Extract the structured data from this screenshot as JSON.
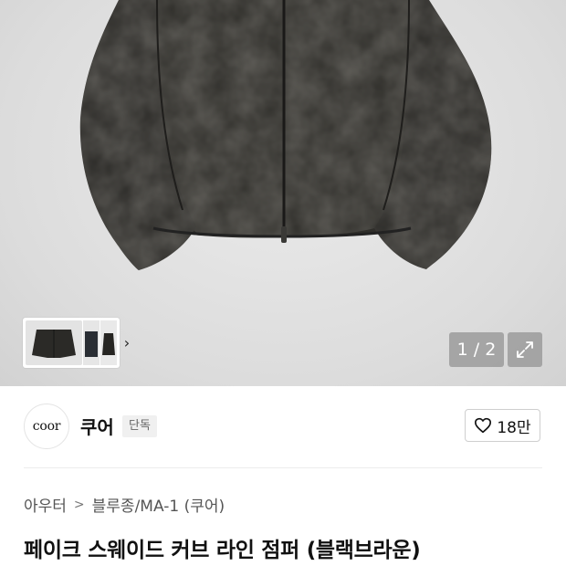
{
  "gallery": {
    "image_alt": "black brown faux suede curve line jumper",
    "pager_text": "1 / 2",
    "thumb_next_icon": "chevron-right-icon",
    "expand_icon": "expand-icon"
  },
  "brand": {
    "logo_text": "coor",
    "name": "쿠어",
    "badge": "단독",
    "like_icon": "heart-outline-icon",
    "like_count": "18만"
  },
  "breadcrumb": {
    "items": [
      "아우터",
      "블루종/MA-1 (쿠어)"
    ],
    "separator_icon": "chevron-right-icon"
  },
  "product": {
    "title": "페이크 스웨이드 커브 라인 점퍼 (블랙브라운)"
  },
  "colors": {
    "jacket": "#2f2e2a",
    "background": "#dedede",
    "overlay": "#969696"
  }
}
